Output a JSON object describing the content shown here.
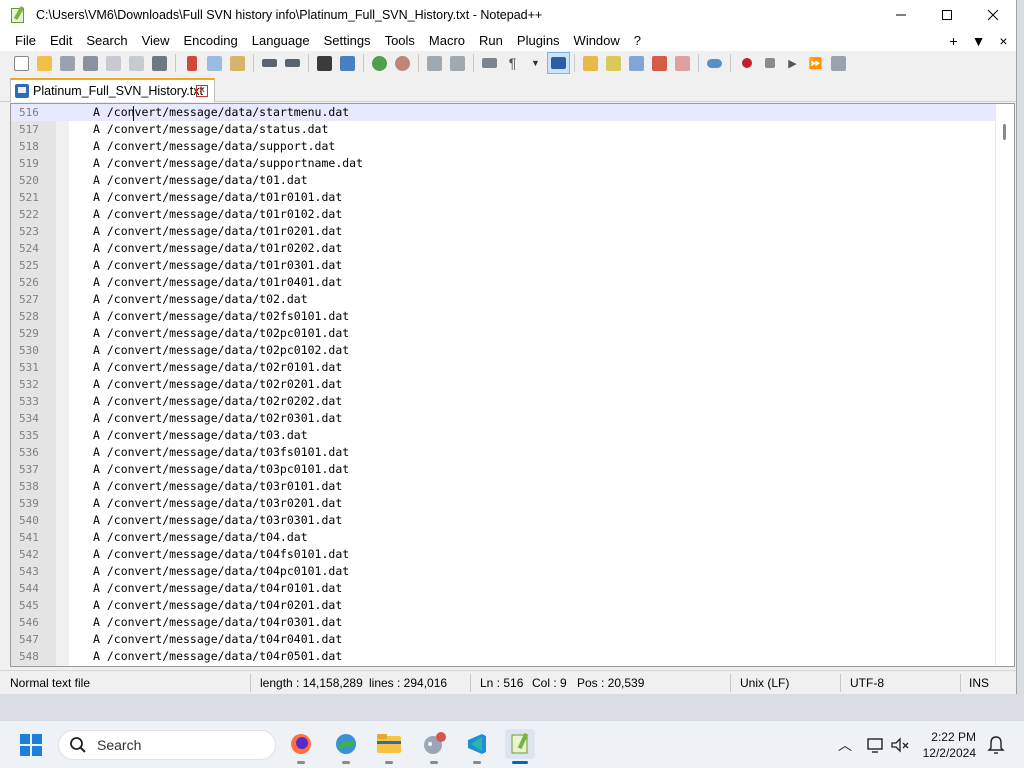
{
  "window": {
    "title": "C:\\Users\\VM6\\Downloads\\Full SVN history info\\Platinum_Full_SVN_History.txt - Notepad++"
  },
  "menu": {
    "items": [
      "File",
      "Edit",
      "Search",
      "View",
      "Encoding",
      "Language",
      "Settings",
      "Tools",
      "Macro",
      "Run",
      "Plugins",
      "Window",
      "?"
    ],
    "right": [
      "+",
      "▼",
      "×"
    ]
  },
  "toolbar": {
    "icons": [
      "new-file-icon",
      "open-file-icon",
      "save-icon",
      "save-all-icon",
      "close-icon",
      "close-all-icon",
      "print-icon",
      "cut-icon",
      "copy-icon",
      "paste-icon",
      "undo-icon",
      "redo-icon",
      "find-icon",
      "replace-icon",
      "zoom-in-icon",
      "zoom-out-icon",
      "sync-vertical-icon",
      "sync-horizontal-icon",
      "word-wrap-icon",
      "show-all-chars-icon",
      "indent-guide-icon",
      "user-defined-lang-icon",
      "document-map-icon",
      "document-list-icon",
      "function-list-icon",
      "folder-workspace-icon",
      "monitoring-icon",
      "record-macro-icon",
      "stop-record-icon",
      "play-macro-icon",
      "run-macro-multiple-icon",
      "save-macro-icon"
    ]
  },
  "tab": {
    "label": "Platinum_Full_SVN_History.txt"
  },
  "editor": {
    "lines": [
      {
        "n": "516",
        "t": "A /convert/message/data/startmenu.dat"
      },
      {
        "n": "517",
        "t": "A /convert/message/data/status.dat"
      },
      {
        "n": "518",
        "t": "A /convert/message/data/support.dat"
      },
      {
        "n": "519",
        "t": "A /convert/message/data/supportname.dat"
      },
      {
        "n": "520",
        "t": "A /convert/message/data/t01.dat"
      },
      {
        "n": "521",
        "t": "A /convert/message/data/t01r0101.dat"
      },
      {
        "n": "522",
        "t": "A /convert/message/data/t01r0102.dat"
      },
      {
        "n": "523",
        "t": "A /convert/message/data/t01r0201.dat"
      },
      {
        "n": "524",
        "t": "A /convert/message/data/t01r0202.dat"
      },
      {
        "n": "525",
        "t": "A /convert/message/data/t01r0301.dat"
      },
      {
        "n": "526",
        "t": "A /convert/message/data/t01r0401.dat"
      },
      {
        "n": "527",
        "t": "A /convert/message/data/t02.dat"
      },
      {
        "n": "528",
        "t": "A /convert/message/data/t02fs0101.dat"
      },
      {
        "n": "529",
        "t": "A /convert/message/data/t02pc0101.dat"
      },
      {
        "n": "530",
        "t": "A /convert/message/data/t02pc0102.dat"
      },
      {
        "n": "531",
        "t": "A /convert/message/data/t02r0101.dat"
      },
      {
        "n": "532",
        "t": "A /convert/message/data/t02r0201.dat"
      },
      {
        "n": "533",
        "t": "A /convert/message/data/t02r0202.dat"
      },
      {
        "n": "534",
        "t": "A /convert/message/data/t02r0301.dat"
      },
      {
        "n": "535",
        "t": "A /convert/message/data/t03.dat"
      },
      {
        "n": "536",
        "t": "A /convert/message/data/t03fs0101.dat"
      },
      {
        "n": "537",
        "t": "A /convert/message/data/t03pc0101.dat"
      },
      {
        "n": "538",
        "t": "A /convert/message/data/t03r0101.dat"
      },
      {
        "n": "539",
        "t": "A /convert/message/data/t03r0201.dat"
      },
      {
        "n": "540",
        "t": "A /convert/message/data/t03r0301.dat"
      },
      {
        "n": "541",
        "t": "A /convert/message/data/t04.dat"
      },
      {
        "n": "542",
        "t": "A /convert/message/data/t04fs0101.dat"
      },
      {
        "n": "543",
        "t": "A /convert/message/data/t04pc0101.dat"
      },
      {
        "n": "544",
        "t": "A /convert/message/data/t04r0101.dat"
      },
      {
        "n": "545",
        "t": "A /convert/message/data/t04r0201.dat"
      },
      {
        "n": "546",
        "t": "A /convert/message/data/t04r0301.dat"
      },
      {
        "n": "547",
        "t": "A /convert/message/data/t04r0401.dat"
      },
      {
        "n": "548",
        "t": "A /convert/message/data/t04r0501.dat"
      }
    ]
  },
  "status": {
    "file_type": "Normal text file",
    "length": "length : 14,158,289",
    "lines": "lines : 294,016",
    "ln": "Ln : 516",
    "col": "Col : 9",
    "pos": "Pos : 20,539",
    "eol": "Unix (LF)",
    "encoding": "UTF-8",
    "mode": "INS"
  },
  "taskbar": {
    "search_label": "Search",
    "time": "2:22 PM",
    "date": "12/2/2024",
    "apps": [
      "firefox-icon",
      "browser-globe-icon",
      "file-explorer-icon",
      "app-robot-icon",
      "visual-studio-code-icon",
      "notepad-plus-plus-icon"
    ]
  },
  "colors": {
    "accent": "#0067c0",
    "tab_highlight": "#f5a623",
    "current_line": "#e8e8ff"
  }
}
